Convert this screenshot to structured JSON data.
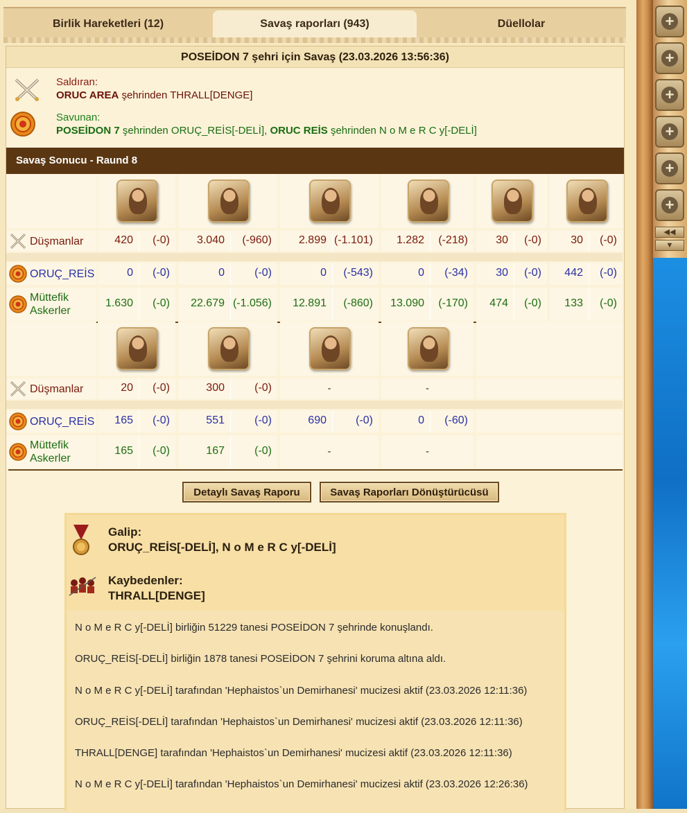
{
  "tabs": [
    {
      "label": "Birlik Hareketleri (12)"
    },
    {
      "label": "Savaş raporları (943)"
    },
    {
      "label": "Düellolar"
    }
  ],
  "report": {
    "title": "POSEİDON 7 şehri için Savaş (23.03.2026 13:56:36)",
    "attacker_label": "Saldıran:",
    "attacker_city": "ORUC AREA",
    "attacker_rest": " şehrinden THRALL[DENGE]",
    "defender_label": "Savunan:",
    "defender_city1": "POSEİDON 7",
    "defender_rest1": " şehrinden ORUÇ_REİS[-DELİ], ",
    "defender_city2": "ORUC REİS",
    "defender_rest2": " şehrinden N o M e R C y[-DELİ]",
    "result_bar": "Savaş Sonucu - Raund 8"
  },
  "rows": {
    "enemies": "Düşmanlar",
    "oruc": "ORUÇ_REİS",
    "allies_line1": "Müttefik",
    "allies_line2": "Askerler"
  },
  "units_top": [
    {
      "icon": "slinger-unit-icon",
      "enemy": [
        "420",
        "(-0)"
      ],
      "oruc": [
        "0",
        "(-0)"
      ],
      "allies": [
        "1.630",
        "(-0)"
      ]
    },
    {
      "icon": "swordsman-unit-icon",
      "enemy": [
        "3.040",
        "(-960)"
      ],
      "oruc": [
        "0",
        "(-0)"
      ],
      "allies": [
        "22.679",
        "(-1.056)"
      ]
    },
    {
      "icon": "hoplite-unit-icon",
      "enemy": [
        "2.899",
        "(-1.101)"
      ],
      "oruc": [
        "0",
        "(-543)"
      ],
      "allies": [
        "12.891",
        "(-860)"
      ]
    },
    {
      "icon": "catapult-unit-icon",
      "enemy": [
        "1.282",
        "(-218)"
      ],
      "oruc": [
        "0",
        "(-34)"
      ],
      "allies": [
        "13.090",
        "(-170)"
      ]
    },
    {
      "icon": "chariot-unit-icon",
      "enemy": [
        "30",
        "(-0)"
      ],
      "oruc": [
        "30",
        "(-0)"
      ],
      "allies": [
        "474",
        "(-0)"
      ]
    },
    {
      "icon": "siege-tower-unit-icon",
      "enemy": [
        "30",
        "(-0)"
      ],
      "oruc": [
        "442",
        "(-0)"
      ],
      "allies": [
        "133",
        "(-0)"
      ]
    }
  ],
  "units_bottom": [
    {
      "icon": "philosopher-unit-icon",
      "enemy": [
        "20",
        "(-0)"
      ],
      "oruc": [
        "165",
        "(-0)"
      ],
      "allies": [
        "165",
        "(-0)"
      ]
    },
    {
      "icon": "cook-unit-icon",
      "enemy": [
        "300",
        "(-0)"
      ],
      "oruc": [
        "551",
        "(-0)"
      ],
      "allies": [
        "167",
        "(-0)"
      ]
    },
    {
      "icon": "shield-warrior-unit-icon",
      "enemy": [
        "-"
      ],
      "oruc": [
        "690",
        "(-0)"
      ],
      "allies": [
        "-"
      ]
    },
    {
      "icon": "war-wagon-unit-icon",
      "enemy": [
        "-"
      ],
      "oruc": [
        "0",
        "(-60)"
      ],
      "allies": [
        "-"
      ]
    }
  ],
  "buttons": {
    "detailed": "Detaylı Savaş Raporu",
    "converter": "Savaş Raporları Dönüştürücüsü"
  },
  "result": {
    "winner_label": "Galip:",
    "winner_value": "ORUÇ_REİS[-DELİ], N o M e R C y[-DELİ]",
    "loser_label": "Kaybedenler:",
    "loser_value": "THRALL[DENGE]",
    "lines": [
      "N o M e R C y[-DELİ] birliğin 51229 tanesi POSEİDON 7 şehrinde konuşlandı.",
      "ORUÇ_REİS[-DELİ] birliğin 1878 tanesi POSEİDON 7 şehrini koruma altına aldı.",
      "N o M e R C y[-DELİ] tarafından 'Hephaistos`un Demirhanesi' mucizesi aktif (23.03.2026 12:11:36)",
      "ORUÇ_REİS[-DELİ] tarafından 'Hephaistos`un Demirhanesi' mucizesi aktif (23.03.2026 12:11:36)",
      "THRALL[DENGE] tarafından 'Hephaistos`un Demirhanesi' mucizesi aktif (23.03.2026 12:11:36)",
      "N o M e R C y[-DELİ] tarafından 'Hephaistos`un Demirhanesi' mucizesi aktif (23.03.2026 12:26:36)"
    ]
  },
  "colors": {
    "attacker": "#8b1a10",
    "defender": "#1e7f1a",
    "header_bar": "#5a3612",
    "own_numbers": "#2a2fa6"
  }
}
